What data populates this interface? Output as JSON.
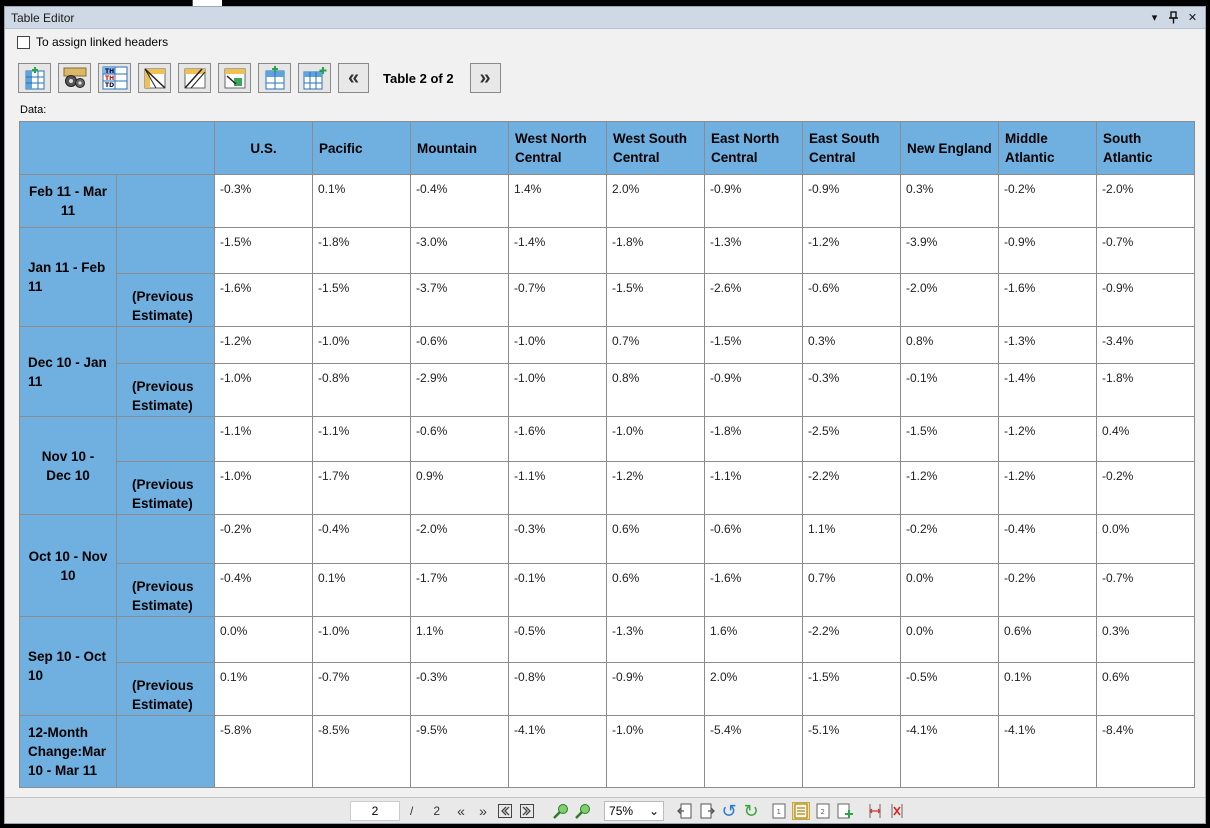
{
  "window": {
    "title": "Table Editor",
    "controls": [
      "▾",
      "📌",
      "✕"
    ]
  },
  "options": {
    "assign_linked_headers_label": "To assign linked headers",
    "assign_linked_headers_checked": false
  },
  "toolbar": {
    "table_count": "Table 2 of 2",
    "prev_label": "«",
    "next_label": "»"
  },
  "data_label": "Data:",
  "table": {
    "columns": [
      "U.S.",
      "Pacific",
      "Mountain",
      "West North Central",
      "West South Central",
      "East North Central",
      "East South Central",
      "New England",
      "Middle Atlantic",
      "South Atlantic"
    ],
    "groups": [
      {
        "label": "Feb 11 - Mar 11",
        "rows": [
          {
            "sub": "",
            "values": [
              "-0.3%",
              "0.1%",
              "-0.4%",
              "1.4%",
              "2.0%",
              "-0.9%",
              "-0.9%",
              "0.3%",
              "-0.2%",
              "-2.0%"
            ]
          }
        ]
      },
      {
        "label": "Jan 11 - Feb 11",
        "rows": [
          {
            "sub": "",
            "values": [
              "-1.5%",
              "-1.8%",
              "-3.0%",
              "-1.4%",
              "-1.8%",
              "-1.3%",
              "-1.2%",
              "-3.9%",
              "-0.9%",
              "-0.7%"
            ]
          },
          {
            "sub": "(Previous Estimate)",
            "values": [
              "-1.6%",
              "-1.5%",
              "-3.7%",
              "-0.7%",
              "-1.5%",
              "-2.6%",
              "-0.6%",
              "-2.0%",
              "-1.6%",
              "-0.9%"
            ]
          }
        ]
      },
      {
        "label": "Dec 10 - Jan 11",
        "rows": [
          {
            "sub": "",
            "values": [
              "-1.2%",
              "-1.0%",
              "-0.6%",
              "-1.0%",
              "0.7%",
              "-1.5%",
              "0.3%",
              "0.8%",
              "-1.3%",
              "-3.4%"
            ]
          },
          {
            "sub": "(Previous Estimate)",
            "values": [
              "-1.0%",
              "-0.8%",
              "-2.9%",
              "-1.0%",
              "0.8%",
              "-0.9%",
              "-0.3%",
              "-0.1%",
              "-1.4%",
              "-1.8%"
            ]
          }
        ]
      },
      {
        "label": "Nov 10 - Dec 10",
        "rows": [
          {
            "sub": "",
            "values": [
              "-1.1%",
              "-1.1%",
              "-0.6%",
              "-1.6%",
              "-1.0%",
              "-1.8%",
              "-2.5%",
              "-1.5%",
              "-1.2%",
              "0.4%"
            ]
          },
          {
            "sub": "(Previous Estimate)",
            "values": [
              "-1.0%",
              "-1.7%",
              "0.9%",
              "-1.1%",
              "-1.2%",
              "-1.1%",
              "-2.2%",
              "-1.2%",
              "-1.2%",
              "-0.2%"
            ]
          }
        ]
      },
      {
        "label": "Oct 10 - Nov 10",
        "rows": [
          {
            "sub": "",
            "values": [
              "-0.2%",
              "-0.4%",
              "-2.0%",
              "-0.3%",
              "0.6%",
              "-0.6%",
              "1.1%",
              "-0.2%",
              "-0.4%",
              "0.0%"
            ]
          },
          {
            "sub": "(Previous Estimate)",
            "values": [
              "-0.4%",
              "0.1%",
              "-1.7%",
              "-0.1%",
              "0.6%",
              "-1.6%",
              "0.7%",
              "0.0%",
              "-0.2%",
              "-0.7%"
            ]
          }
        ]
      },
      {
        "label": "Sep 10 - Oct 10",
        "rows": [
          {
            "sub": "",
            "values": [
              "0.0%",
              "-1.0%",
              "1.1%",
              "-0.5%",
              "-1.3%",
              "1.6%",
              "-2.2%",
              "0.0%",
              "0.6%",
              "0.3%"
            ]
          },
          {
            "sub": "(Previous Estimate)",
            "values": [
              "0.1%",
              "-0.7%",
              "-0.3%",
              "-0.8%",
              "-0.9%",
              "2.0%",
              "-1.5%",
              "-0.5%",
              "0.1%",
              "0.6%"
            ]
          }
        ]
      },
      {
        "label": "12-Month Change:Mar 10 - Mar 11",
        "rows": [
          {
            "sub": "",
            "values": [
              "-5.8%",
              "-8.5%",
              "-9.5%",
              "-4.1%",
              "-1.0%",
              "-5.4%",
              "-5.1%",
              "-4.1%",
              "-4.1%",
              "-8.4%"
            ]
          }
        ]
      }
    ]
  },
  "statusbar": {
    "current_page": "2",
    "separator": "/",
    "total_pages": "2",
    "zoom": "75%",
    "zoom_arrow": "⌄"
  },
  "colors": {
    "header_bg": "#6fb0e0",
    "cell_bg": "#ffffff",
    "border": "#8c8c8c"
  }
}
